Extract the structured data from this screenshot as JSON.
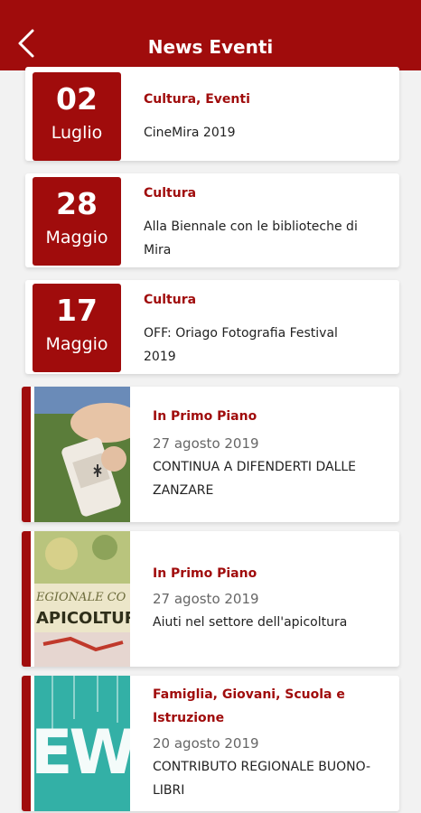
{
  "header": {
    "title": "News Eventi",
    "back_icon": "chevron-left-icon"
  },
  "events": [
    {
      "day": "02",
      "month": "Luglio",
      "category": "Cultura, Eventi",
      "title": "CineMira 2019"
    },
    {
      "day": "28",
      "month": "Maggio",
      "category": "Cultura",
      "title": "Alla Biennale con le biblioteche di Mira"
    },
    {
      "day": "17",
      "month": "Maggio",
      "category": "Cultura",
      "title": "OFF: Oriago Fotografia Festival 2019"
    }
  ],
  "news": [
    {
      "category": "In Primo Piano",
      "date": "27 agosto 2019",
      "title": "CONTINUA A DIFENDERTI DALLE ZANZARE"
    },
    {
      "category": "In Primo Piano",
      "date": "27 agosto 2019",
      "title": "Aiuti nel settore dell'apicoltura",
      "image_text_1": "EGIONALE CO",
      "image_text_2": "APICOLTUR"
    },
    {
      "category": "Famiglia, Giovani, Scuola e Istruzione",
      "date": "20 agosto 2019",
      "title": "CONTRIBUTO REGIONALE BUONO-LIBRI",
      "image_text": "EW"
    }
  ],
  "colors": {
    "accent": "#a00c0c",
    "background": "#f2f2f2",
    "card": "#ffffff"
  }
}
